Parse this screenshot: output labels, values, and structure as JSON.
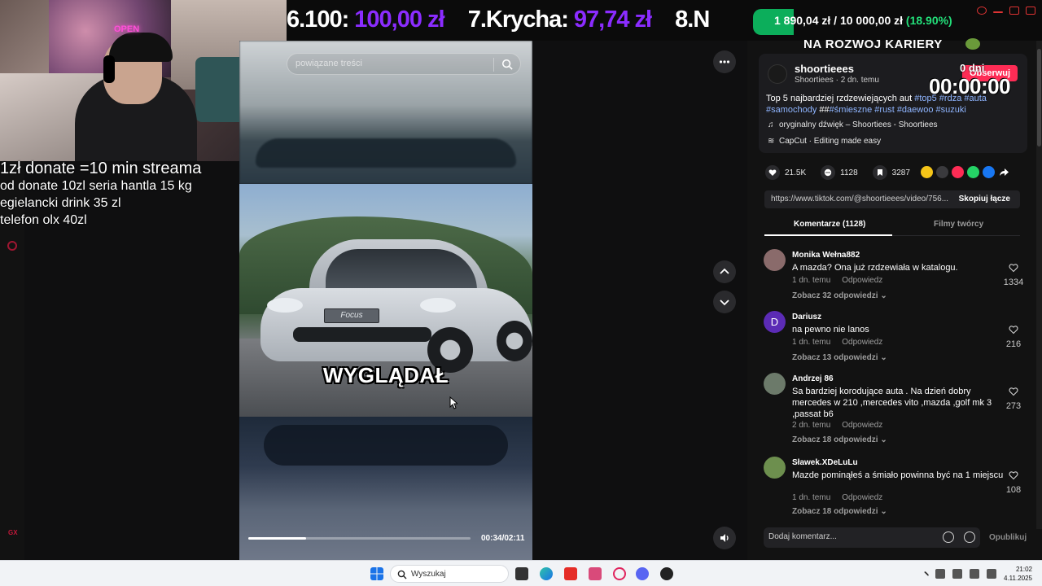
{
  "overlay": {
    "donate_lines": [
      "1zł donate =10 min streama",
      "od donate 10zl seria hantla 15 kg",
      "egielancki drink 35 zl",
      "telefon olx 40zl"
    ],
    "webcam_neon": "OPEN"
  },
  "ticker": {
    "items": [
      {
        "name": "6.100:",
        "value": "100,00 zł"
      },
      {
        "name": "7.Krycha:",
        "value": "97,74 zł"
      },
      {
        "name": "8.N",
        "value": ""
      }
    ]
  },
  "goal": {
    "current": "1 890,04 zł",
    "target": "/ 10 000,00 zł",
    "percent": "(18.90%)",
    "progress_fraction": 0.189
  },
  "video": {
    "search_placeholder": "powiązane treści",
    "caption": "WYGLĄDAŁ",
    "plate_text": "Focus",
    "time": "00:34/02:11",
    "progress_fraction": 0.26
  },
  "stream_overlay": {
    "career_title": "NA ROZWOJ KARIERY",
    "days": "0 dni",
    "clock": "00:00:00"
  },
  "author": {
    "name": "shoortieees",
    "sub": "Shoortiees · 2 dn. temu",
    "follow_label": "Obserwuj",
    "description_plain": "Top 5 najbardziej rzdzewiejących aut ",
    "tags_line1": "#top5 #rdza #auta",
    "tags_line2a": "#samochody",
    "desc_mid": " ##",
    "tags_line2b": "#śmieszne #rust #daewoo #suzuki",
    "music": "oryginalny dźwięk – Shoortiees - Shoortiees",
    "capcut": "CapCut · Editing made easy"
  },
  "stats": {
    "likes": "21.5K",
    "comments": "1128",
    "saves": "3287"
  },
  "share_colors": [
    "#f5c518",
    "#3a3a3d",
    "#fe2c55",
    "#25d366",
    "#1877f2"
  ],
  "url": {
    "text": "https://www.tiktok.com/@shoortieees/video/756...",
    "copy_label": "Skopiuj łącze"
  },
  "tabs": {
    "comments": "Komentarze (1128)",
    "creator_videos": "Filmy twórcy"
  },
  "comments": [
    {
      "user": "Monika Wełna882",
      "text": "A mazda? Ona już rzdzewiała w katalogu.",
      "time": "1 dn. temu",
      "reply": "Odpowiedz",
      "more": "Zobacz 32 odpowiedzi",
      "likes": "1334",
      "avatar_color": "#8a6b6b"
    },
    {
      "user": "Dariusz",
      "text": "na pewno nie lanos",
      "time": "1 dn. temu",
      "reply": "Odpowiedz",
      "more": "Zobacz 13 odpowiedzi",
      "likes": "216",
      "avatar_color": "#5b2bb5",
      "avatar_letter": "D"
    },
    {
      "user": "Andrzej 86",
      "text": "Sa bardziej korodujące auta . Na dzień dobry mercedes w 210 ,mercedes vito ,mazda ,golf mk 3 ,passat b6",
      "time": "2 dn. temu",
      "reply": "Odpowiedz",
      "more": "Zobacz 18 odpowiedzi",
      "likes": "273",
      "avatar_color": "#6c7a6a"
    },
    {
      "user": "Sławek.XDeLuLu",
      "text": "Mazde pominąłeś a śmiało powinna być na 1 miejscu",
      "time": "1 dn. temu",
      "reply": "Odpowiedz",
      "more": "Zobacz 18 odpowiedzi",
      "likes": "108",
      "avatar_color": "#6d8f4e"
    }
  ],
  "comment_input": {
    "placeholder": "Dodaj komentarz...",
    "publish": "Opublikuj"
  },
  "taskbar": {
    "search_placeholder": "Wyszukaj",
    "time": "21:02",
    "date": "4.11.2025"
  },
  "sidebar": {
    "gx_label": "GX"
  },
  "colors": {
    "accent_pink": "#fe2c55",
    "ticker_value": "#8b2cff",
    "goal_green": "#0cae5b"
  }
}
